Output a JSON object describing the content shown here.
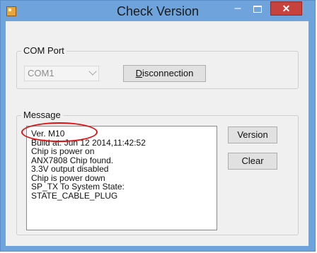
{
  "window": {
    "title": "Check Version"
  },
  "com_port": {
    "group_label": "COM Port",
    "selected_port": "COM1",
    "disconnect_label": "Disconnection"
  },
  "message": {
    "group_label": "Message",
    "lines": [
      "Ver. M10",
      "Build at: Jun 12 2014,11:42:52",
      "Chip is power on",
      "ANX7808 Chip found.",
      "3.3V output disabled",
      "Chip is power down",
      "SP_TX To System State:",
      "STATE_CABLE_PLUG"
    ],
    "version_label": "Version",
    "clear_label": "Clear"
  },
  "colors": {
    "titlebar": "#6fa3dc",
    "close_button": "#c7423d",
    "highlight_ellipse": "#e01010"
  }
}
